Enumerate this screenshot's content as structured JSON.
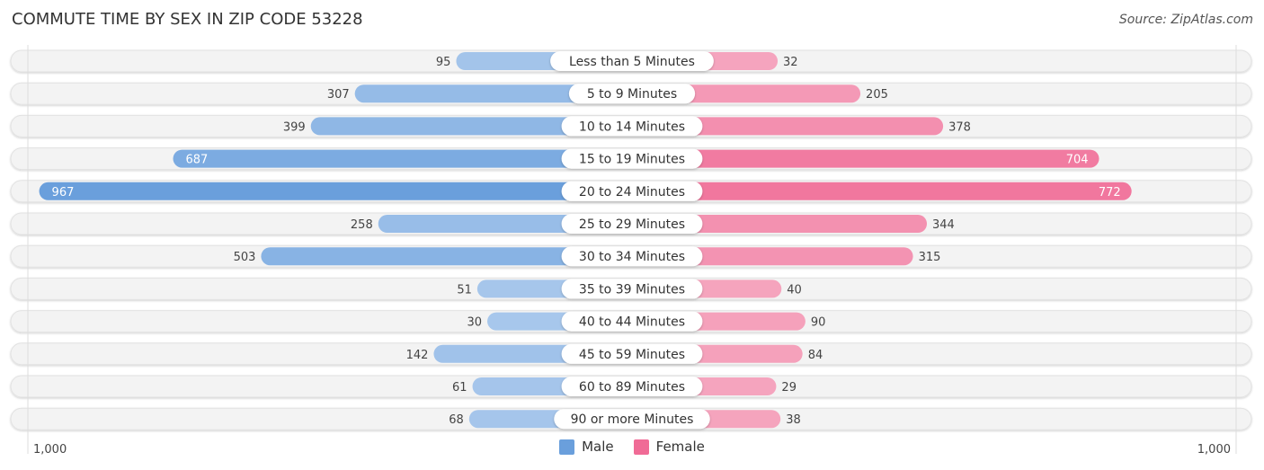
{
  "title": "COMMUTE TIME BY SEX IN ZIP CODE 53228",
  "source": "Source: ZipAtlas.com",
  "colors": {
    "male": "#6a9fdc",
    "male_light": "#a9c8ec",
    "female": "#f06b96",
    "female_light": "#f5a6bf"
  },
  "legend": {
    "male": "Male",
    "female": "Female"
  },
  "axis": {
    "left_label": "1,000",
    "right_label": "1,000"
  },
  "chart_data": {
    "type": "bar",
    "orientation": "horizontal-diverging",
    "title": "COMMUTE TIME BY SEX IN ZIP CODE 53228",
    "categories": [
      "Less than 5 Minutes",
      "5 to 9 Minutes",
      "10 to 14 Minutes",
      "15 to 19 Minutes",
      "20 to 24 Minutes",
      "25 to 29 Minutes",
      "30 to 34 Minutes",
      "35 to 39 Minutes",
      "40 to 44 Minutes",
      "45 to 59 Minutes",
      "60 to 89 Minutes",
      "90 or more Minutes"
    ],
    "series": [
      {
        "name": "Male",
        "values": [
          95,
          307,
          399,
          687,
          967,
          258,
          503,
          51,
          30,
          142,
          61,
          68
        ]
      },
      {
        "name": "Female",
        "values": [
          32,
          205,
          378,
          704,
          772,
          344,
          315,
          40,
          90,
          84,
          29,
          38
        ]
      }
    ],
    "xlim": [
      -1000,
      1000
    ],
    "legend_position": "bottom-center",
    "grid": false
  }
}
